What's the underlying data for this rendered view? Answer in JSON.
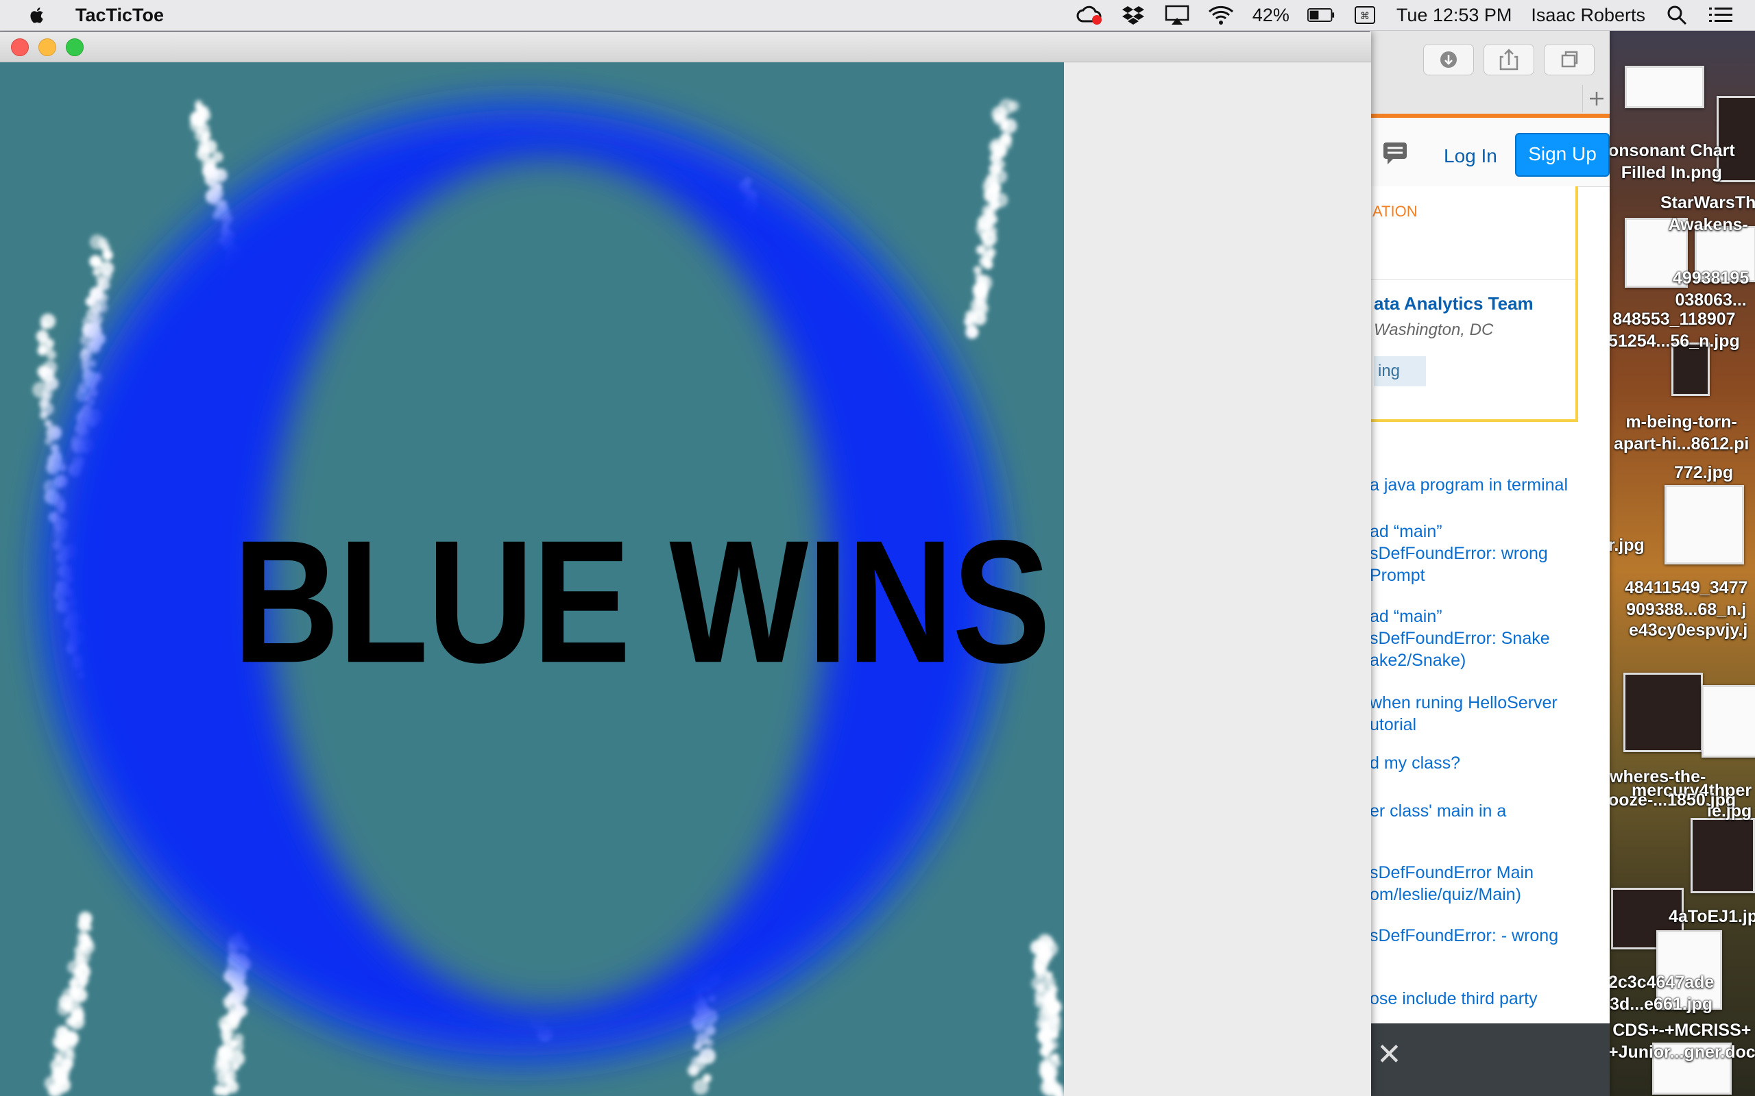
{
  "menubar": {
    "app_name": "TacTicToe",
    "battery": "42%",
    "clock": "Tue 12:53 PM",
    "user": "Isaac Roberts",
    "icons": [
      "apple-icon",
      "creative-cloud-icon",
      "dropbox-icon",
      "airplay-icon",
      "wifi-icon",
      "battery-icon",
      "keyboard-shortcut-icon",
      "search-icon",
      "menu-list-icon"
    ]
  },
  "game": {
    "window_title": "",
    "result_text": "BLUE WINS",
    "colors": {
      "board": "#3e7d88",
      "ring": "#0a32f0",
      "text": "#000000"
    }
  },
  "browser": {
    "login": "Log In",
    "signup": "Sign Up",
    "job_partial_header": "ATION",
    "job_title": "ata Analytics Team",
    "job_location": "Washington, DC",
    "job_tag": "ing",
    "related": [
      [
        "a java program in terminal"
      ],
      [
        "ad “main”",
        "sDefFoundError: wrong",
        "Prompt"
      ],
      [
        "ad “main”",
        "sDefFoundError: Snake",
        "ake2/Snake)"
      ],
      [
        "when runing HelloServer",
        "utorial"
      ],
      [
        "d my class?"
      ],
      [
        "er class' main in a"
      ],
      [
        "sDefFoundError Main",
        "om/leslie/quiz/Main)"
      ],
      [
        "sDefFoundError: - wrong"
      ],
      [
        "ose include third party"
      ]
    ],
    "close_glyph": "✕"
  },
  "desktop_files": [
    {
      "l1": "onsonant Chart",
      "l2": "Filled In.png"
    },
    {
      "l1": "StarWarsTh",
      "l2": "Awakens-"
    },
    {
      "l1": "49938195",
      "l2": "038063..."
    },
    {
      "l1": "848553_118907",
      "l2": "51254...56_n.jpg"
    },
    {
      "l1": "m-being-torn-",
      "l2": "apart-hi...8612.pi"
    },
    {
      "l1": "772.jpg",
      "l2": ""
    },
    {
      "l1": "r.jpg",
      "l2": ""
    },
    {
      "l1": "48411549_3477",
      "l2": "909388...68_n.j"
    },
    {
      "l1": "e43cy0espvjy.j",
      "l2": ""
    },
    {
      "l1": "wheres-the-",
      "l2": "mercury4thper"
    },
    {
      "l1": "ooze-...1850.jpg",
      "l2": "ie.jpg"
    },
    {
      "l1": "4aToEJ1.jp",
      "l2": ""
    },
    {
      "l1": "2c3c4647ade",
      "l2": "3d...e661.jpg"
    },
    {
      "l1": "CDS+-+MCRISS+",
      "l2": "+Junior...gner.doc"
    }
  ]
}
